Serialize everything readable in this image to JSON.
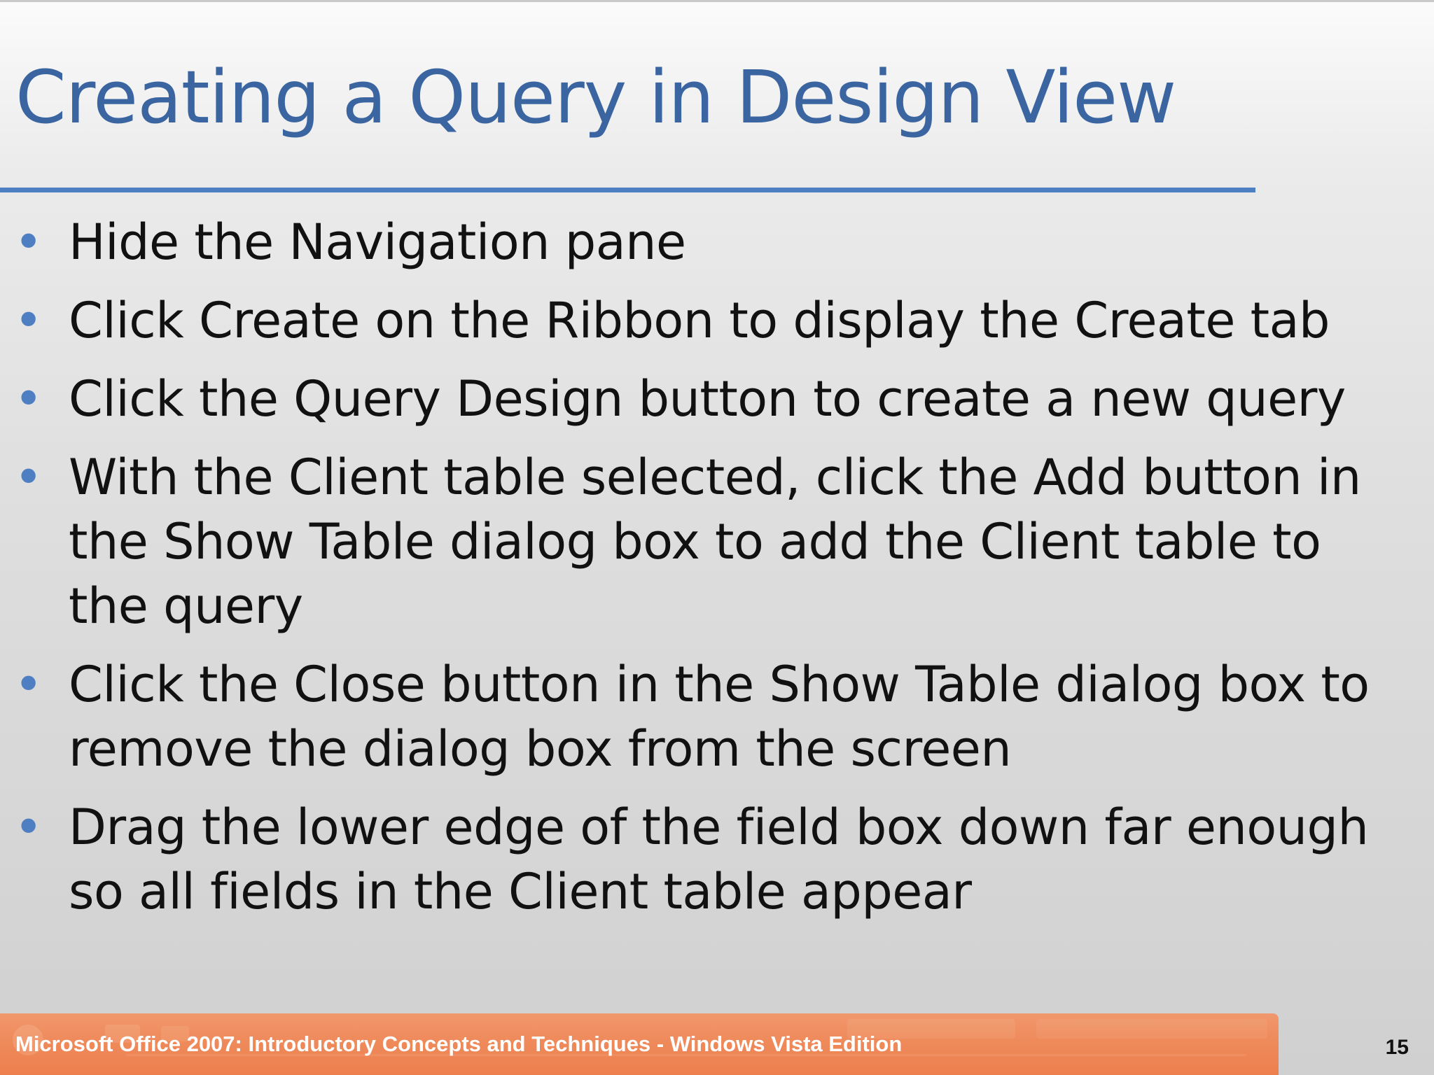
{
  "slide": {
    "title": "Creating a Query in Design View",
    "bullets": [
      "Hide the Navigation pane",
      "Click Create on the Ribbon to display the Create tab",
      "Click the Query Design button to create a new query",
      "With the Client table selected, click the Add button in the Show Table dialog box to add the Client table to the query",
      "Click the Close button in the Show Table dialog box to remove the dialog box from the screen",
      "Drag the lower edge of the field box down far enough so all fields in the Client table appear"
    ],
    "bullet_symbol": "•"
  },
  "footer": {
    "text": "Microsoft Office 2007: Introductory Concepts and Techniques - Windows Vista Edition",
    "page_number": "15"
  },
  "colors": {
    "title": "#3a65a0",
    "rule": "#4f7fc3",
    "bullet": "#4f7fc3",
    "footer_bar": "#ef8b5c"
  }
}
